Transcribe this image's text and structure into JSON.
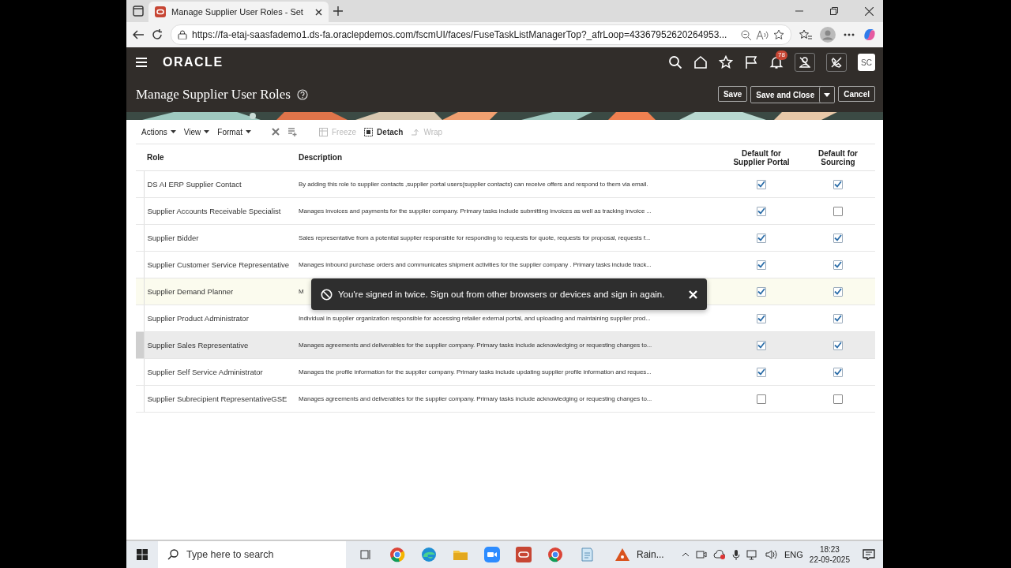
{
  "browser": {
    "tab_title": "Manage Supplier User Roles - Set",
    "url": "https://fa-etaj-saasfademo1.ds-fa.oraclepdemos.com/fscmUI/faces/FuseTaskListManagerTop?_afrLoop=43367952620264953..."
  },
  "header": {
    "logo": "ORACLE",
    "notification_count": "78",
    "avatar": "SC"
  },
  "page": {
    "title": "Manage Supplier User Roles",
    "buttons": [
      {
        "label": "Save",
        "kind": "plain"
      },
      {
        "label": "Save and Close",
        "kind": "split"
      },
      {
        "label": "Cancel",
        "kind": "plain"
      }
    ]
  },
  "toolbar": {
    "menus": [
      "Actions",
      "View",
      "Format"
    ],
    "tools": [
      {
        "label": "Freeze",
        "disabled": true
      },
      {
        "label": "Detach",
        "disabled": false
      },
      {
        "label": "Wrap",
        "disabled": true
      }
    ]
  },
  "table": {
    "columns": [
      "Role",
      "Description",
      "Default for Supplier Portal",
      "Default for Sourcing"
    ],
    "rows": [
      {
        "role": "DS AI ERP Supplier Contact",
        "description": "By adding this role to supplier contacts ,supplier portal users(supplier contacts) can receive offers and respond to them via email.",
        "portal": true,
        "sourcing": true,
        "selected": false,
        "hovered": false
      },
      {
        "role": "Supplier Accounts Receivable Specialist",
        "description": "Manages invoices and payments for the supplier company. Primary tasks include submitting invoices as well as tracking invoice ...",
        "portal": true,
        "sourcing": false,
        "selected": false,
        "hovered": false
      },
      {
        "role": "Supplier Bidder",
        "description": "Sales representative from a potential supplier responsible for responding to requests for quote, requests for proposal, requests f...",
        "portal": true,
        "sourcing": true,
        "selected": false,
        "hovered": false
      },
      {
        "role": "Supplier Customer Service Representative",
        "description": "Manages inbound purchase orders and communicates shipment activities for the supplier company . Primary tasks include track...",
        "portal": true,
        "sourcing": true,
        "selected": false,
        "hovered": false
      },
      {
        "role": "Supplier Demand Planner",
        "description": "M",
        "portal": true,
        "sourcing": true,
        "selected": false,
        "hovered": true
      },
      {
        "role": "Supplier Product Administrator",
        "description": "Individual in supplier organization responsible for accessing retailer external portal, and uploading and maintaining supplier prod...",
        "portal": true,
        "sourcing": true,
        "selected": false,
        "hovered": false
      },
      {
        "role": "Supplier Sales Representative",
        "description": "Manages agreements and deliverables for the supplier company. Primary tasks include acknowledging or requesting changes to...",
        "portal": true,
        "sourcing": true,
        "selected": true,
        "hovered": false
      },
      {
        "role": "Supplier Self Service Administrator",
        "description": "Manages the profile information for the supplier company. Primary tasks include updating supplier profile information and reques...",
        "portal": true,
        "sourcing": true,
        "selected": false,
        "hovered": false
      },
      {
        "role": "Supplier Subrecipient RepresentativeGSE",
        "description": "Manages agreements and deliverables for the supplier company. Primary tasks include acknowledging or requesting changes to...",
        "portal": false,
        "sourcing": false,
        "selected": false,
        "hovered": false
      }
    ]
  },
  "toast": {
    "message": "You're signed in twice. Sign out from other browsers or devices and sign in again."
  },
  "taskbar": {
    "search_placeholder": "Type here to search",
    "weather": "Rain...",
    "language": "ENG",
    "time": "18:23",
    "date": "22-09-2025"
  }
}
